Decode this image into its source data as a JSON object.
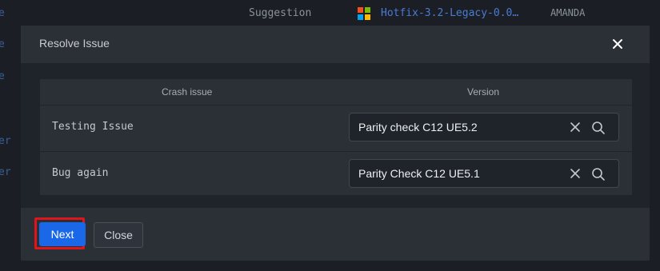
{
  "background": {
    "suggestion": "Suggestion",
    "hotfix": "Hotfix-3.2-Legacy-0.0…",
    "user": "AMANDA",
    "edge_chars": [
      "e",
      "e",
      "e",
      "er",
      "er"
    ],
    "windows_icon_colors": [
      "#f25022",
      "#7fba00",
      "#00a4ef",
      "#ffb900"
    ]
  },
  "modal": {
    "title": "Resolve Issue",
    "close_icon": "close-icon",
    "columns": {
      "crash": "Crash issue",
      "version": "Version"
    },
    "rows": [
      {
        "issue": "Testing Issue",
        "version": "Parity check C12 UE5.2"
      },
      {
        "issue": "Bug again",
        "version": "Parity Check C12 UE5.1"
      }
    ],
    "buttons": {
      "next": "Next",
      "close": "Close"
    }
  },
  "colors": {
    "primary": "#1a68e8",
    "highlight": "#e0141b"
  }
}
